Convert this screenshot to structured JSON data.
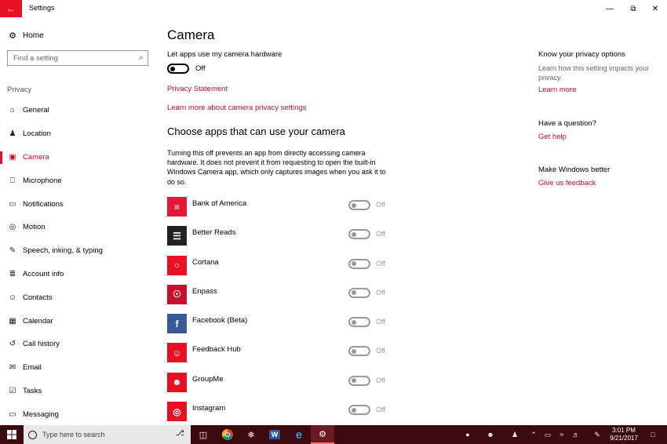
{
  "window": {
    "title": "Settings",
    "back_icon": "←",
    "minimize_icon": "—",
    "restore_icon": "⧉",
    "close_icon": "✕"
  },
  "sidebar": {
    "home_label": "Home",
    "home_icon": "⚙",
    "search_placeholder": "Find a setting",
    "search_icon": "⌕",
    "section_label": "Privacy",
    "items": [
      {
        "label": "General",
        "icon": "⌂"
      },
      {
        "label": "Location",
        "icon": "♟"
      },
      {
        "label": "Camera",
        "icon": "▣"
      },
      {
        "label": "Microphone",
        "icon": "⎕"
      },
      {
        "label": "Notifications",
        "icon": "▭"
      },
      {
        "label": "Motion",
        "icon": "◎"
      },
      {
        "label": "Speech, inking, & typing",
        "icon": "✎"
      },
      {
        "label": "Account info",
        "icon": "≣"
      },
      {
        "label": "Contacts",
        "icon": "☺"
      },
      {
        "label": "Calendar",
        "icon": "▦"
      },
      {
        "label": "Call history",
        "icon": "↺"
      },
      {
        "label": "Email",
        "icon": "✉"
      },
      {
        "label": "Tasks",
        "icon": "☑"
      },
      {
        "label": "Messaging",
        "icon": "▭"
      }
    ]
  },
  "main": {
    "title": "Camera",
    "master_label": "Let apps use my camera hardware",
    "master_state": "Off",
    "privacy_statement": "Privacy Statement",
    "learn_more": "Learn more about camera privacy settings",
    "apps_heading": "Choose apps that can use your camera",
    "apps_description": "Turning this off prevents an app from directly accessing camera hardware. It does not prevent it from requesting to open the built-in Windows Camera app, which only captures images when you ask it to do so.",
    "apps": [
      {
        "name": "Bank of America",
        "state": "Off",
        "icon_color": "#e31837",
        "glyph": "≡"
      },
      {
        "name": "Better Reads",
        "state": "Off",
        "icon_color": "#222222",
        "glyph": "☰"
      },
      {
        "name": "Cortana",
        "state": "Off",
        "icon_color": "#e81123",
        "glyph": "○"
      },
      {
        "name": "Enpass",
        "state": "Off",
        "icon_color": "#c8102e",
        "glyph": "☉"
      },
      {
        "name": "Facebook (Beta)",
        "state": "Off",
        "icon_color": "#3b5998",
        "glyph": "f"
      },
      {
        "name": "Feedback Hub",
        "state": "Off",
        "icon_color": "#e81123",
        "glyph": "☺"
      },
      {
        "name": "GroupMe",
        "state": "Off",
        "icon_color": "#e81123",
        "glyph": "☻"
      },
      {
        "name": "Instagram",
        "state": "Off",
        "icon_color": "#e81123",
        "glyph": "◎"
      }
    ]
  },
  "right": {
    "privacy_heading": "Know your privacy options",
    "privacy_sub": "Learn how this setting impacts your privacy.",
    "privacy_link": "Learn more",
    "question_heading": "Have a question?",
    "question_link": "Get help",
    "better_heading": "Make Windows better",
    "better_link": "Give us feedback"
  },
  "taskbar": {
    "search_placeholder": "Type here to search",
    "time": "3:01 PM",
    "date": "9/21/2017"
  }
}
